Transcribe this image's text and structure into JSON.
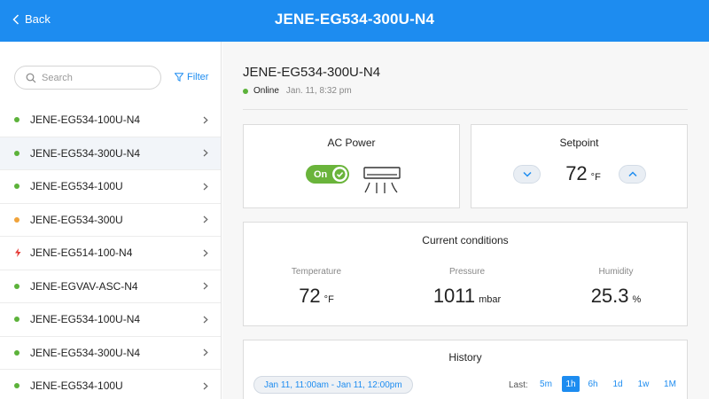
{
  "header": {
    "back_label": "Back",
    "title": "JENE-EG534-300U-N4"
  },
  "sidebar": {
    "search_placeholder": "Search",
    "filter_label": "Filter",
    "items": [
      {
        "name": "JENE-EG534-100U-N4",
        "status": "online"
      },
      {
        "name": "JENE-EG534-300U-N4",
        "status": "online",
        "selected": true
      },
      {
        "name": "JENE-EG534-100U",
        "status": "online"
      },
      {
        "name": "JENE-EG534-300U",
        "status": "warning"
      },
      {
        "name": "JENE-EG514-100-N4",
        "status": "alarm"
      },
      {
        "name": "JENE-EGVAV-ASC-N4",
        "status": "online"
      },
      {
        "name": "JENE-EG534-100U-N4",
        "status": "online"
      },
      {
        "name": "JENE-EG534-300U-N4",
        "status": "online"
      },
      {
        "name": "JENE-EG534-100U",
        "status": "online"
      }
    ]
  },
  "device": {
    "title": "JENE-EG534-300U-N4",
    "status": "Online",
    "timestamp": "Jan. 11, 8:32 pm"
  },
  "ac_power": {
    "title": "AC Power",
    "toggle_label": "On",
    "icon": "air-conditioner-icon"
  },
  "setpoint": {
    "title": "Setpoint",
    "value": "72",
    "unit": "°F"
  },
  "conditions": {
    "title": "Current conditions",
    "temperature": {
      "label": "Temperature",
      "value": "72",
      "unit": "°F"
    },
    "pressure": {
      "label": "Pressure",
      "value": "1011",
      "unit": "mbar"
    },
    "humidity": {
      "label": "Humidity",
      "value": "25.3",
      "unit": "%"
    }
  },
  "history": {
    "title": "History",
    "range": "Jan 11, 11:00am - Jan 11, 12:00pm",
    "last_label": "Last:",
    "ranges": [
      "5m",
      "1h",
      "6h",
      "1d",
      "1w",
      "1M"
    ],
    "active_range": "1h"
  },
  "colors": {
    "brand": "#1d8cf0",
    "online": "#5cb23a",
    "warning": "#f0a33a",
    "alarm": "#e53935",
    "toggle_on": "#6ab43b"
  }
}
